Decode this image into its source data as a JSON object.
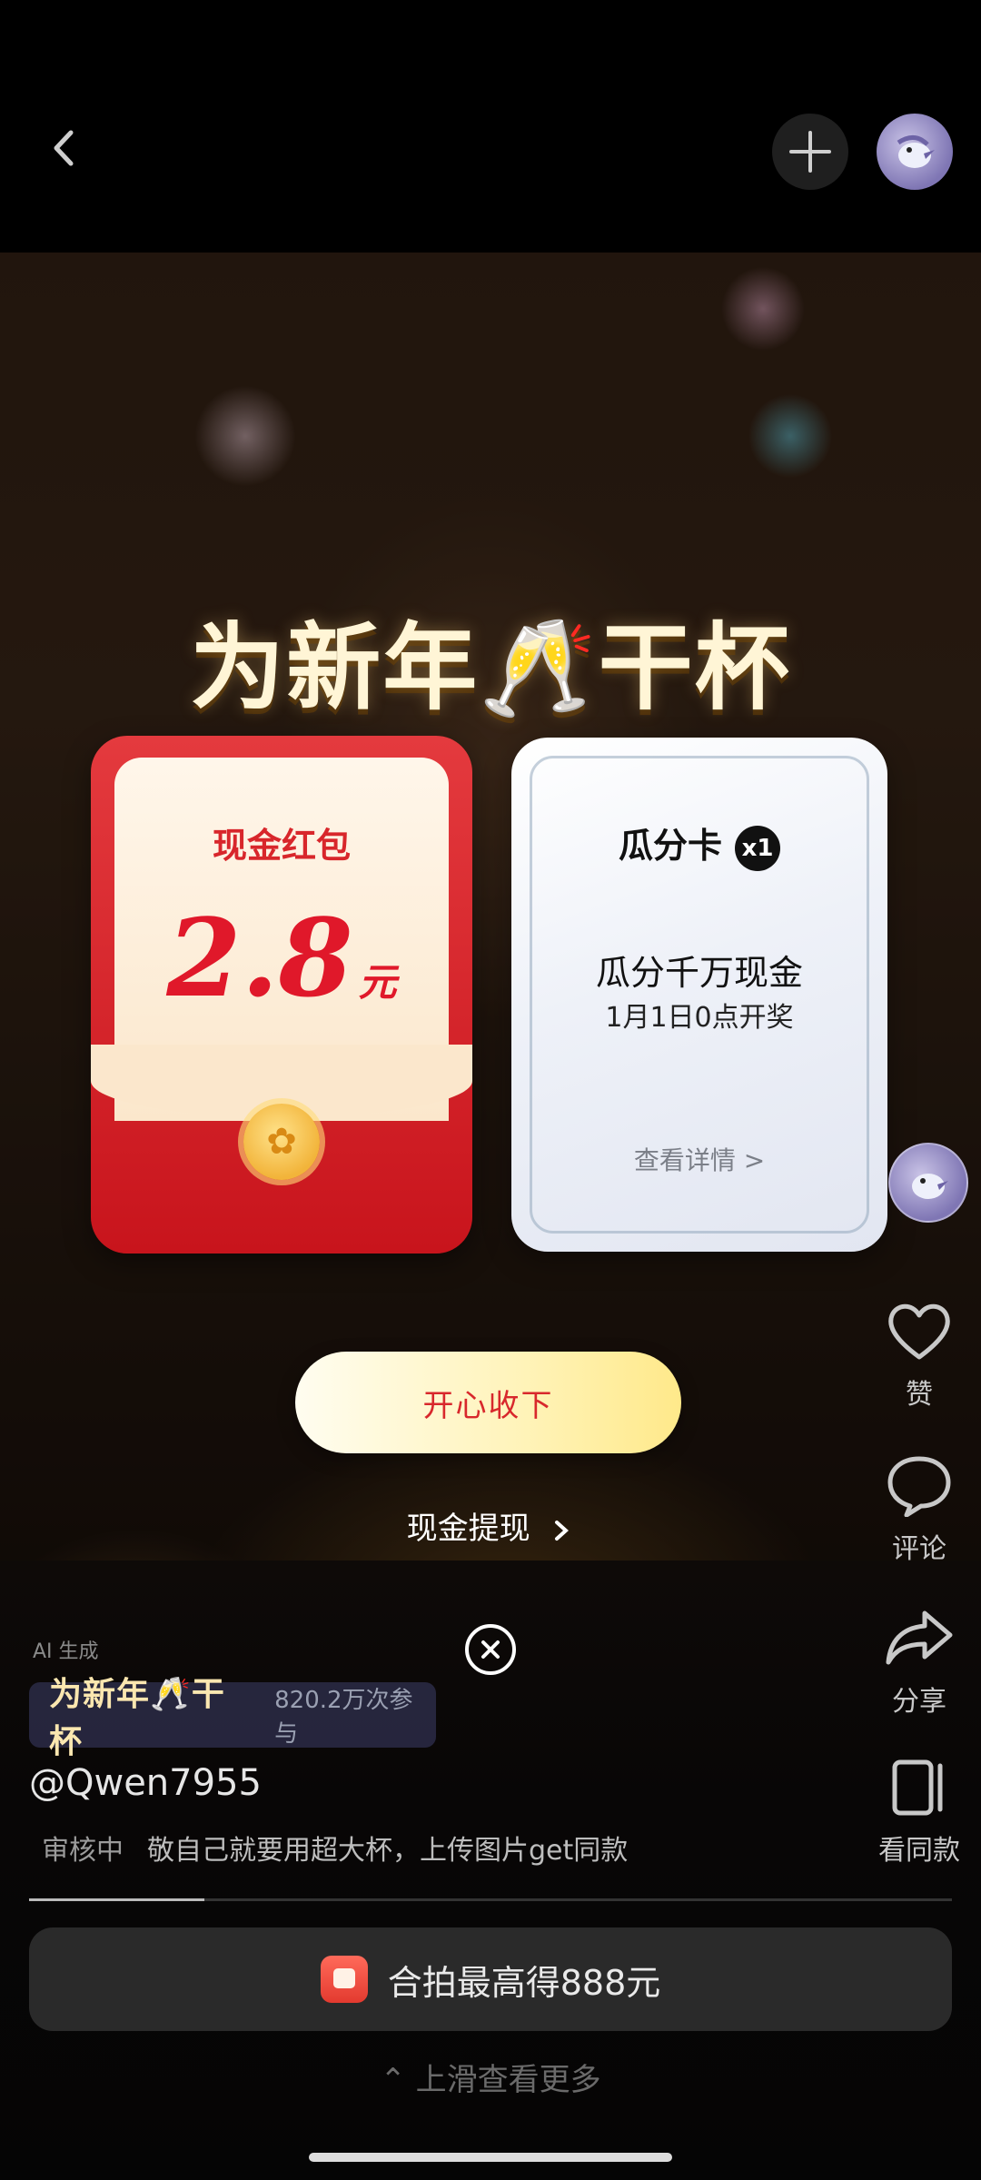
{
  "overlay": {
    "headline": "为新年🥂干杯",
    "red_packet": {
      "title": "现金红包",
      "amount": "2.8",
      "unit": "元"
    },
    "card": {
      "name": "瓜分卡",
      "count": "x1",
      "main_text": "瓜分千万现金",
      "sub_text": "1月1日0点开奖",
      "link": "查看详情 >"
    },
    "accept_label": "开心收下",
    "withdraw_label": "现金提现",
    "close_icon": "close-circle-icon"
  },
  "rail": {
    "like": {
      "label": "赞",
      "icon": "heart-icon"
    },
    "comment": {
      "label": "评论",
      "icon": "comment-icon"
    },
    "share": {
      "label": "分享",
      "icon": "share-icon"
    },
    "same": {
      "label": "看同款",
      "icon": "template-icon"
    }
  },
  "post": {
    "ai_tag": "AI 生成",
    "campaign_title": "为新年🥂干杯",
    "campaign_count": "820.2万次参与",
    "username": "@Qwen7955",
    "status": "审核中",
    "caption": "敬自己就要用超大杯，上传图片get同款",
    "progress": 0.19
  },
  "cta": {
    "label": "合拍最高得888元"
  },
  "swipe_hint": "⌃ 上滑查看更多"
}
